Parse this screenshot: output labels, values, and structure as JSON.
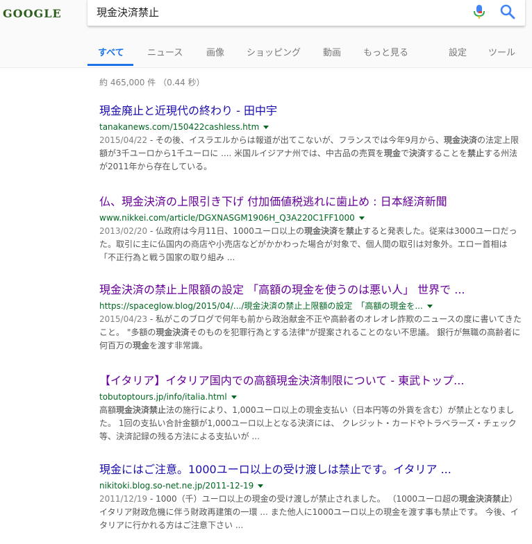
{
  "logo_text": "GOOGLE",
  "search": {
    "query": "現金決済禁止"
  },
  "tabs": [
    {
      "label": "すべて"
    },
    {
      "label": "ニュース"
    },
    {
      "label": "画像"
    },
    {
      "label": "ショッピング"
    },
    {
      "label": "動画"
    },
    {
      "label": "もっと見る"
    },
    {
      "label": "設定"
    },
    {
      "label": "ツール"
    }
  ],
  "stats": "約 465,000 件 （0.44 秒）",
  "colors": {
    "link": "#1a0dab",
    "visited": "#660099",
    "url": "#006621",
    "accent": "#1a73e8"
  },
  "results": [
    {
      "title": "現金廃止と近現代の終わり - 田中宇",
      "url": "tanakanews.com/150422cashless.htm",
      "date": "2015/04/22",
      "snippet": [
        {
          "t": " - その後、イスラエルからは報道が出てこないが、フランスでは今年9月から、"
        },
        {
          "b": "現金決済"
        },
        {
          "t": "の法定上限額が3千ユーロから1千ユーロに .... 米国ルイジアナ州では、中古品の売買を"
        },
        {
          "b": "現金"
        },
        {
          "t": "で"
        },
        {
          "b": "決済"
        },
        {
          "t": "することを"
        },
        {
          "b": "禁止"
        },
        {
          "t": "する州法が2011年から存在している。"
        }
      ]
    },
    {
      "title": "仏、現金決済の上限引き下げ 付加価値税逃れに歯止め : 日本経済新聞",
      "url": "www.nikkei.com/article/DGXNASGM1906H_Q3A220C1FF1000",
      "date": "2013/02/20",
      "snippet": [
        {
          "t": " - 仏政府は今月11日、1000ユーロ以上の"
        },
        {
          "b": "現金決済"
        },
        {
          "t": "を"
        },
        {
          "b": "禁止"
        },
        {
          "t": "すると発表した。従来は3000ユーロだった。取引に主に仏国内の商店や小売店などがかかわった場合が対象で、個人間の取引は対象外。エロー首相は「不正行為と戦う国家の取り組み ..."
        }
      ]
    },
    {
      "title": "現金決済の禁止上限額の設定 「高額の現金を使うのは悪い人」 世界で ...",
      "url": "https://spaceglow.blog/2015/04/.../現金決済の禁止上限額の設定　「高額の現金を...",
      "date": "2015/04/23",
      "snippet": [
        {
          "t": " - 私がこのブログで何年も前から政治献金不正や高齢者のオレオレ詐欺のニュースの度に書いてきたこと。 \"多額の"
        },
        {
          "b": "現金決済"
        },
        {
          "t": "そのものを犯罪行為とする法律\"が提案されることのない不思議。 銀行が無職の高齢者に何百万の"
        },
        {
          "b": "現金"
        },
        {
          "t": "を渡す非常識。"
        }
      ]
    },
    {
      "title": "【イタリア】イタリア国内での高額現金決済制限について - 東武トップ...",
      "url": "tobutoptours.jp/info/italia.html",
      "date": "",
      "snippet": [
        {
          "t": "高額"
        },
        {
          "b": "現金決済禁止"
        },
        {
          "t": "法の施行により、1,000ユーロ以上の現金支払い（日本円等の外貨を含む）が禁止となりました。 1回の支払い合計金額が1,000ユーロ以上となる決済には、 クレジット・カードやトラベラーズ・チェック等、決済記録の残る方法による支払いが ..."
        }
      ]
    },
    {
      "title": "現金にはご注意。1000ユーロ以上の受け渡しは禁止です。イタリア ...",
      "url": "nikitoki.blog.so-net.ne.jp/2011-12-19",
      "date": "2011/12/19",
      "snippet": [
        {
          "t": " - 1000（千）ユーロ以上の現金の受け渡しが禁止されました。 （1000ユーロ超の"
        },
        {
          "b": "現金決済禁止"
        },
        {
          "t": "） イタリア財政危機に伴う財政再建策の一環 ... また他人に1000ユーロ以上の現金を渡す事も禁止です。 今後、イタリアに行かれる方はご注意下さい ..."
        }
      ]
    }
  ]
}
